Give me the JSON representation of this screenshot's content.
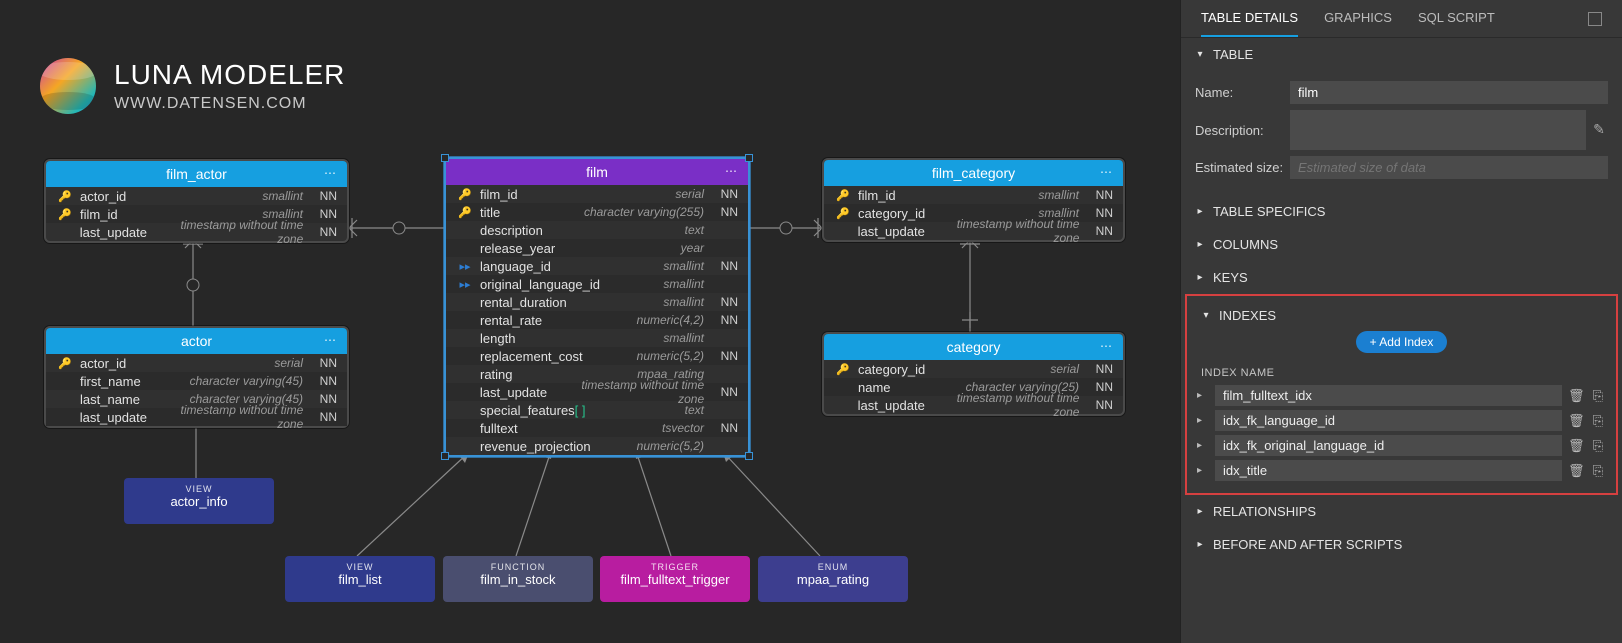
{
  "logo": {
    "title": "LUNA MODELER",
    "subtitle": "WWW.DATENSEN.COM"
  },
  "tables": {
    "film_actor": {
      "title": "film_actor",
      "cols": [
        {
          "ic": "pkfk",
          "name": "actor_id",
          "type": "smallint",
          "nn": "NN"
        },
        {
          "ic": "pkfk",
          "name": "film_id",
          "type": "smallint",
          "nn": "NN"
        },
        {
          "ic": "",
          "name": "last_update",
          "type": "timestamp without time zone",
          "nn": "NN"
        }
      ]
    },
    "actor": {
      "title": "actor",
      "cols": [
        {
          "ic": "pk",
          "name": "actor_id",
          "type": "serial",
          "nn": "NN"
        },
        {
          "ic": "",
          "name": "first_name",
          "type": "character varying(45)",
          "nn": "NN"
        },
        {
          "ic": "",
          "name": "last_name",
          "type": "character varying(45)",
          "nn": "NN"
        },
        {
          "ic": "",
          "name": "last_update",
          "type": "timestamp without time zone",
          "nn": "NN"
        }
      ]
    },
    "film": {
      "title": "film",
      "cols": [
        {
          "ic": "pk",
          "name": "film_id",
          "type": "serial",
          "nn": "NN"
        },
        {
          "ic": "pk",
          "name": "title",
          "type": "character varying(255)",
          "nn": "NN"
        },
        {
          "ic": "",
          "name": "description",
          "type": "text",
          "nn": ""
        },
        {
          "ic": "",
          "name": "release_year",
          "type": "year",
          "nn": ""
        },
        {
          "ic": "fk",
          "name": "language_id",
          "type": "smallint",
          "nn": "NN"
        },
        {
          "ic": "fk",
          "name": "original_language_id",
          "type": "smallint",
          "nn": ""
        },
        {
          "ic": "",
          "name": "rental_duration",
          "type": "smallint",
          "nn": "NN"
        },
        {
          "ic": "",
          "name": "rental_rate",
          "type": "numeric(4,2)",
          "nn": "NN"
        },
        {
          "ic": "",
          "name": "length",
          "type": "smallint",
          "nn": ""
        },
        {
          "ic": "",
          "name": "replacement_cost",
          "type": "numeric(5,2)",
          "nn": "NN"
        },
        {
          "ic": "",
          "name": "rating",
          "type": "mpaa_rating",
          "nn": ""
        },
        {
          "ic": "",
          "name": "last_update",
          "type": "timestamp without time zone",
          "nn": "NN"
        },
        {
          "ic": "",
          "name": "special_features",
          "bracket": "[ ]",
          "type": "text",
          "nn": ""
        },
        {
          "ic": "",
          "name": "fulltext",
          "type": "tsvector",
          "nn": "NN"
        },
        {
          "ic": "",
          "name": "revenue_projection",
          "type": "numeric(5,2)",
          "nn": ""
        }
      ]
    },
    "film_category": {
      "title": "film_category",
      "cols": [
        {
          "ic": "pkfk",
          "name": "film_id",
          "type": "smallint",
          "nn": "NN"
        },
        {
          "ic": "pkfk",
          "name": "category_id",
          "type": "smallint",
          "nn": "NN"
        },
        {
          "ic": "",
          "name": "last_update",
          "type": "timestamp without time zone",
          "nn": "NN"
        }
      ]
    },
    "category": {
      "title": "category",
      "cols": [
        {
          "ic": "pk",
          "name": "category_id",
          "type": "serial",
          "nn": "NN"
        },
        {
          "ic": "",
          "name": "name",
          "type": "character varying(25)",
          "nn": "NN"
        },
        {
          "ic": "",
          "name": "last_update",
          "type": "timestamp without time zone",
          "nn": "NN"
        }
      ]
    }
  },
  "blocks": {
    "actor_info": {
      "kind": "VIEW",
      "label": "actor_info"
    },
    "film_list": {
      "kind": "VIEW",
      "label": "film_list"
    },
    "film_in_stock": {
      "kind": "FUNCTION",
      "label": "film_in_stock"
    },
    "film_trigger": {
      "kind": "TRIGGER",
      "label": "film_fulltext_trigger"
    },
    "mpaa_rating": {
      "kind": "ENUM",
      "label": "mpaa_rating"
    }
  },
  "panel": {
    "tabs": [
      "TABLE DETAILS",
      "GRAPHICS",
      "SQL SCRIPT"
    ],
    "sections": {
      "table": "TABLE",
      "specifics": "TABLE SPECIFICS",
      "columns": "COLUMNS",
      "keys": "KEYS",
      "indexes": "INDEXES",
      "relationships": "RELATIONSHIPS",
      "scripts": "BEFORE AND AFTER SCRIPTS"
    },
    "labels": {
      "name": "Name:",
      "description": "Description:",
      "estsize": "Estimated size:",
      "estsize_ph": "Estimated size of data",
      "add_index": "+ Add Index",
      "index_name": "INDEX NAME"
    },
    "values": {
      "name": "film"
    },
    "indexes": [
      "film_fulltext_idx",
      "idx_fk_language_id",
      "idx_fk_original_language_id",
      "idx_title"
    ]
  }
}
